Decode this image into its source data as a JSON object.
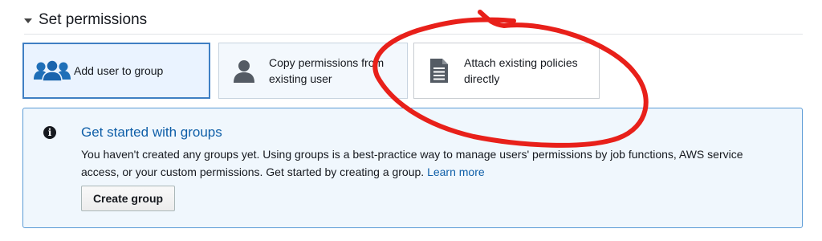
{
  "section": {
    "title": "Set permissions",
    "caret_icon": "caret-down-icon"
  },
  "options": [
    {
      "label": "Add user to group",
      "icon": "user-group-icon",
      "selected": true
    },
    {
      "label_line1": "Copy permissions from",
      "label_line2": "existing user",
      "icon": "user-icon",
      "selected": false
    },
    {
      "label_line1": "Attach existing policies",
      "label_line2": "directly",
      "icon": "document-icon",
      "selected": false
    }
  ],
  "info": {
    "icon": "info-icon",
    "icon_glyph": "i",
    "title": "Get started with groups",
    "body_line1": "You haven't created any groups yet. Using groups is a best-practice way to manage users' permissions by job functions, AWS service",
    "body_line2": "access, or your custom permissions. Get started by creating a group.",
    "link_text": "Learn more",
    "button_label": "Create group"
  },
  "annotation": {
    "color": "#e8201a"
  },
  "colors": {
    "selected_border": "#3f7fc4",
    "info_border": "#5b9bd6",
    "link": "#0f5fa8"
  }
}
